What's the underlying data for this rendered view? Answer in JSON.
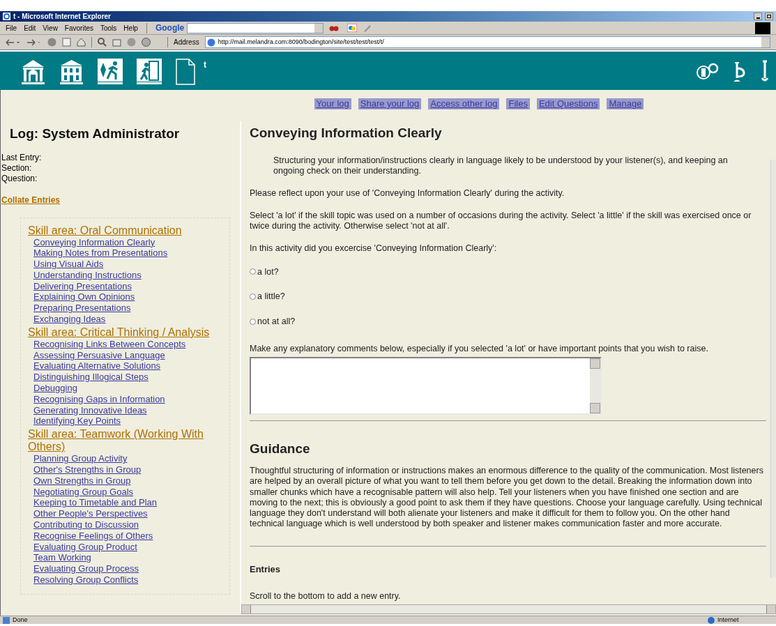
{
  "browser": {
    "title": "t - Microsoft Internet Explorer",
    "menu": [
      "File",
      "Edit",
      "View",
      "Favorites",
      "Tools",
      "Help"
    ],
    "search_label": "Google",
    "address_label": "Address",
    "url": "http://mail.melandra.com:8090/bodington/site/test/test/test/t/",
    "status": "Done",
    "zone": "Internet"
  },
  "header": {
    "title": "t"
  },
  "nav": [
    "Your log",
    "Share your log",
    "Access other log",
    "Files",
    "Edit Questions",
    "Manage"
  ],
  "sidebar": {
    "heading": "Log: System Administrator",
    "info": [
      "Last Entry:",
      "Section:",
      "Question:"
    ],
    "collate": "Collate Entries",
    "areas": [
      {
        "title": "Skill area: Oral Communication",
        "items": [
          "Conveying Information Clearly",
          "Making Notes from Presentations",
          "Using Visual Aids",
          "Understanding Instructions",
          "Delivering Presentations",
          "Explaining Own Opinions",
          "Preparing Presentations",
          "Exchanging Ideas"
        ]
      },
      {
        "title": "Skill area: Critical Thinking / Analysis",
        "items": [
          "Recognising Links Between Concepts",
          "Assessing Persuasive Language",
          "Evaluating Alternative Solutions",
          "Distinguishing Illogical Steps",
          "Debugging",
          "Recognising Gaps in Information",
          "Generating Innovative Ideas",
          "Identifying Key Points"
        ]
      },
      {
        "title": "Skill area: Teamwork (Working With Others)",
        "items": [
          "Planning Group Activity",
          "Other's Strengths in Group",
          "Own Strengths in Group",
          "Negotiating Group Goals",
          "Keeping to Timetable and Plan",
          "Other People's Perspectives",
          "Contributing to Discussion",
          "Recognise Feelings of Others",
          "Evaluating Group Product",
          "Team Working",
          "Evaluating Group Process",
          "Resolving Group Conflicts"
        ]
      }
    ]
  },
  "main": {
    "heading": "Conveying Information Clearly",
    "description": "Structuring your information/instructions clearly in language likely to be understood by your listener(s), and keeping an ongoing check on their understanding.",
    "paragraphs": [
      "Please reflect upon your use of 'Conveying Information Clearly' during the activity.",
      "Select 'a lot' if the skill topic was used on a number of occasions during the activity. Select 'a little' if the skill was exercised once or twice during the activity. Otherwise select 'not at all'.",
      "In this activity did you excercise 'Conveying Information Clearly':"
    ],
    "options": [
      {
        "label": "a lot?",
        "selected": false
      },
      {
        "label": "a little?",
        "selected": false
      },
      {
        "label": "not at all?",
        "selected": false
      }
    ],
    "comments_prompt": "Make any explanatory comments below, especially if you selected 'a lot' or have important points that you wish to raise.",
    "guidance_heading": "Guidance",
    "guidance": "Thoughtful structuring of information or instructions makes an enormous difference to the quality of the communication. Most listeners are helped by an overall picture of what you want to tell them before you get down to the detail. Breaking the information down into smaller chunks which have a recognisable pattern will also help. Tell your listeners when you have finished one section and are moving to the next; this is obviously a good point to ask them if they have questions. Choose your language carefully. Using technical language they don't understand will both alienate your listeners and make it difficult for them to follow you. On the other hand technical language which is well understood by both speaker and listener makes communication faster and more accurate.",
    "entries_heading": "Entries",
    "entries_note": "Scroll to the bottom to add a new entry."
  }
}
